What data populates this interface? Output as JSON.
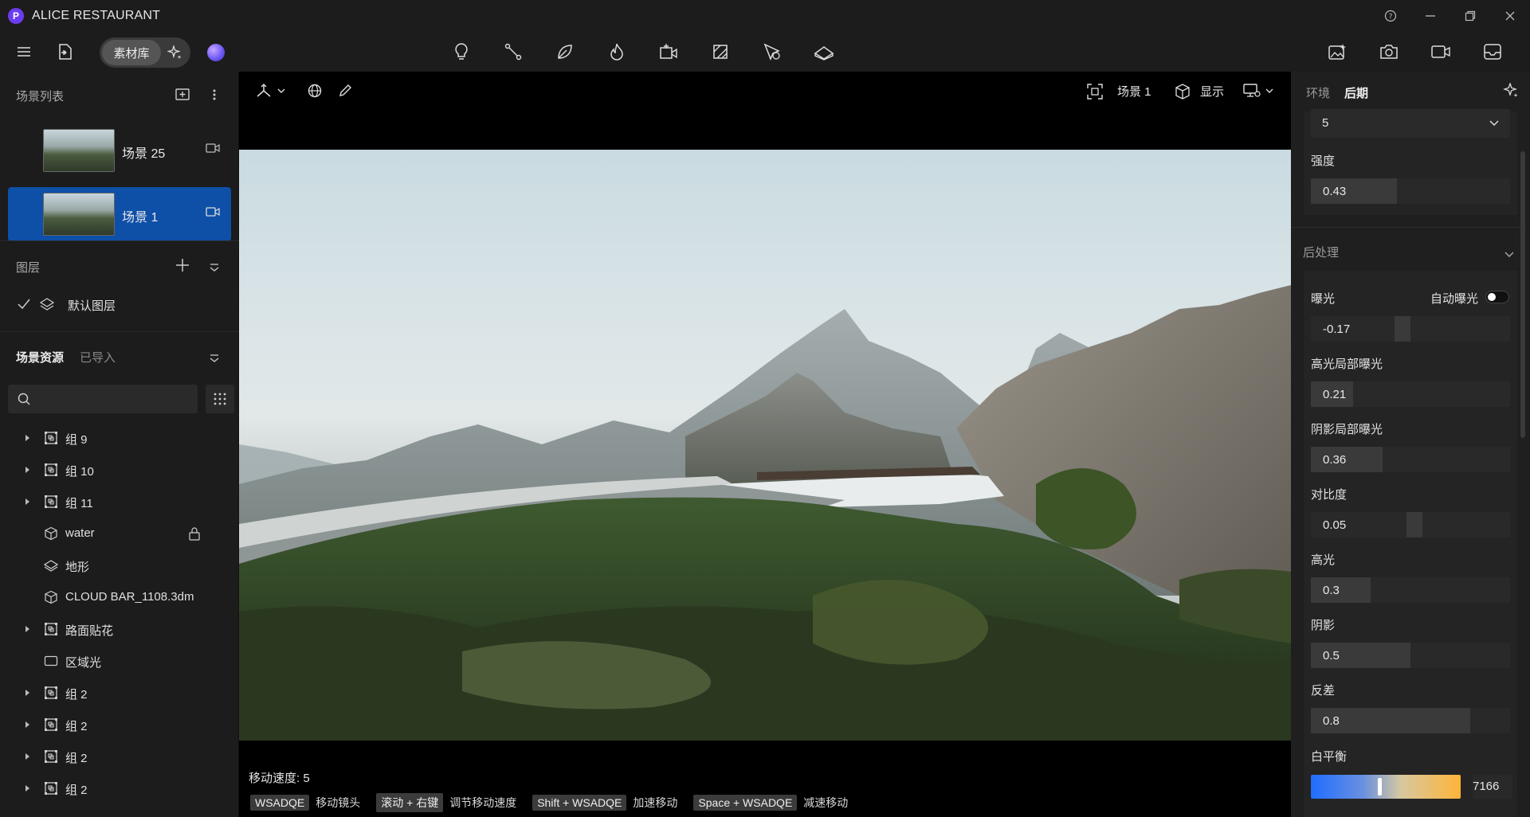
{
  "app": {
    "title": "ALICE RESTAURANT",
    "logo": "P"
  },
  "toolbar": {
    "library_label": "素材库"
  },
  "scene_list": {
    "title": "场景列表",
    "items": [
      {
        "name": "场景 25",
        "selected": false
      },
      {
        "name": "场景 1",
        "selected": true
      }
    ]
  },
  "layers": {
    "title": "图层",
    "items": [
      {
        "name": "默认图层",
        "checked": true
      }
    ]
  },
  "assets": {
    "tabs": [
      "场景资源",
      "已导入"
    ],
    "search_placeholder": "",
    "tree": [
      {
        "label": "组 9",
        "icon": "group-icon",
        "expandable": true
      },
      {
        "label": "组 10",
        "icon": "group-icon",
        "expandable": true
      },
      {
        "label": "组 11",
        "icon": "group-icon",
        "expandable": true
      },
      {
        "label": "water",
        "icon": "cube-icon",
        "expandable": false,
        "locked": true
      },
      {
        "label": "地形",
        "icon": "terrain-icon",
        "expandable": false
      },
      {
        "label": "CLOUD BAR_1108.3dm",
        "icon": "cube-icon",
        "expandable": false
      },
      {
        "label": "路面贴花",
        "icon": "group-icon",
        "expandable": true
      },
      {
        "label": "区域光",
        "icon": "area-light-icon",
        "expandable": false
      },
      {
        "label": "组 2",
        "icon": "group-icon",
        "expandable": true
      },
      {
        "label": "组 2",
        "icon": "group-icon",
        "expandable": true
      },
      {
        "label": "组 2",
        "icon": "group-icon",
        "expandable": true
      },
      {
        "label": "组 2",
        "icon": "group-icon",
        "expandable": true
      }
    ]
  },
  "viewport": {
    "scene_label": "场景 1",
    "display_label": "显示",
    "status": "移动速度: 5",
    "hints": [
      {
        "key": "WSADQE",
        "text": "移动镜头"
      },
      {
        "key": "滚动 + 右键",
        "text": "调节移动速度"
      },
      {
        "key": "Shift + WSADQE",
        "text": "加速移动"
      },
      {
        "key": "Space + WSADQE",
        "text": "减速移动"
      }
    ]
  },
  "right_panel": {
    "tabs": [
      "环境",
      "后期"
    ],
    "active_tab": "后期",
    "dropdown_value": "5",
    "intensity_label": "强度",
    "intensity": {
      "value": "0.43",
      "fraction": 0.43
    },
    "section_title": "后处理",
    "exposure_label": "曝光",
    "auto_exposure_label": "自动曝光",
    "auto_exposure_on": false,
    "sliders": [
      {
        "label": "曝光",
        "value": "-0.17",
        "fraction": 0.46,
        "style": "handle"
      },
      {
        "label": "高光局部曝光",
        "value": "0.21",
        "fraction": 0.21,
        "style": "fill"
      },
      {
        "label": "阴影局部曝光",
        "value": "0.36",
        "fraction": 0.36,
        "style": "fill"
      },
      {
        "label": "对比度",
        "value": "0.05",
        "fraction": 0.52,
        "style": "handle"
      },
      {
        "label": "高光",
        "value": "0.3",
        "fraction": 0.3,
        "style": "fill"
      },
      {
        "label": "阴影",
        "value": "0.5",
        "fraction": 0.5,
        "style": "fill"
      },
      {
        "label": "反差",
        "value": "0.8",
        "fraction": 0.8,
        "style": "fill"
      }
    ],
    "white_balance_label": "白平衡",
    "white_balance_value": "7166",
    "colors": {
      "selected": "#0e4fa8",
      "accent": "#6b3df0",
      "wb_start": "#1f6dff",
      "wb_end": "#ffb43a"
    }
  }
}
